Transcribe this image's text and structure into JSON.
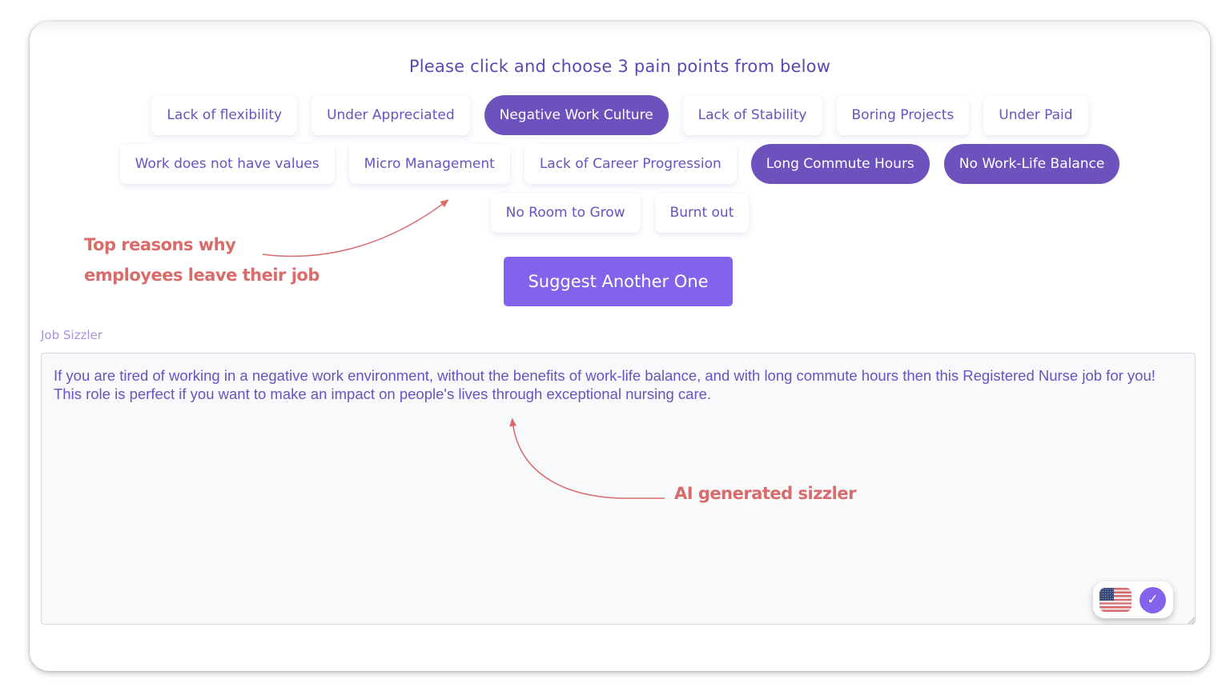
{
  "prompt": "Please click and choose 3 pain points from below",
  "pain_points": {
    "row1": [
      {
        "label": "Lack of flexibility",
        "selected": false
      },
      {
        "label": "Under Appreciated",
        "selected": false
      },
      {
        "label": "Negative Work Culture",
        "selected": true
      },
      {
        "label": "Lack of Stability",
        "selected": false
      },
      {
        "label": "Boring Projects",
        "selected": false
      },
      {
        "label": "Under Paid",
        "selected": false
      }
    ],
    "row2": [
      {
        "label": "Work does not have values",
        "selected": false
      },
      {
        "label": "Micro Management",
        "selected": false
      },
      {
        "label": "Lack of Career Progression",
        "selected": false
      },
      {
        "label": "Long Commute Hours",
        "selected": true
      },
      {
        "label": "No Work-Life Balance",
        "selected": true
      }
    ],
    "row3": [
      {
        "label": "No Room to Grow",
        "selected": false
      },
      {
        "label": "Burnt out",
        "selected": false
      }
    ]
  },
  "suggest_button": "Suggest Another One",
  "annotations": {
    "left_line1": "Top reasons why",
    "left_line2": "employees leave their job",
    "right": "AI generated sizzler"
  },
  "sizzler": {
    "label": "Job Sizzler",
    "value": "If you are tired of working in a negative work environment, without the benefits of work-life balance, and with long commute hours then this Registered Nurse job for you! This role is perfect if you want to make an impact on people's lives through exceptional nursing care."
  },
  "toolbar": {
    "language_icon": "us-flag-icon",
    "confirm_icon": "checkmark-icon",
    "confirm_glyph": "✓"
  },
  "colors": {
    "accent": "#8363ec",
    "selected_chip": "#6d52bd",
    "chip_text": "#6a52c2",
    "annotation": "#d96b6b"
  }
}
